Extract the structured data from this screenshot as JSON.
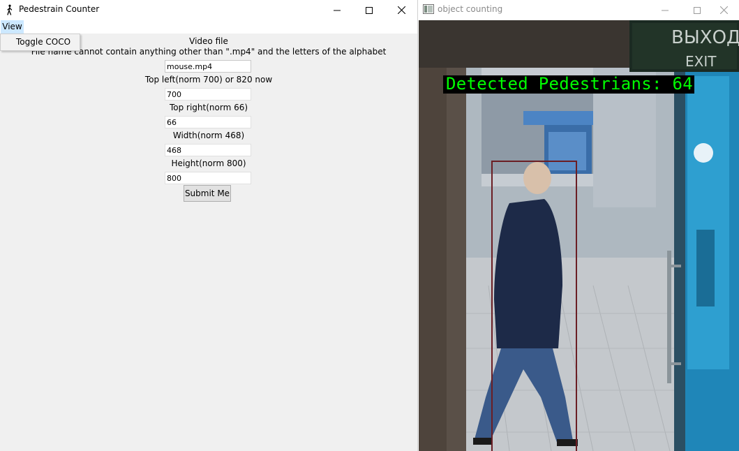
{
  "tk_window": {
    "title": "Pedestrain Counter",
    "menu": {
      "view_label": "View",
      "items": [
        "Toggle COCO"
      ]
    },
    "form": {
      "heading": "Video file",
      "note": "File name cannot contain anything other than \".mp4\" and the letters of the alphabet",
      "fields": [
        {
          "label": "",
          "value": "mouse.mp4"
        },
        {
          "label": "Top left(norm 700) or 820 now",
          "value": "700"
        },
        {
          "label": "Top right(norm 66)",
          "value": "66"
        },
        {
          "label": "Width(norm 468)",
          "value": "468"
        },
        {
          "label": "Height(norm 800)",
          "value": "800"
        }
      ],
      "submit_label": "Submit Me"
    }
  },
  "cv_window": {
    "title": "object counting",
    "overlay_text": "Detected Pedestrians: 64",
    "sign_top": "ВЫХОД",
    "sign_bottom": "EXIT",
    "store_sign": "□□□□□□□□",
    "overlay_color": "#00ff00",
    "bbox_color": "#6b1e24"
  }
}
